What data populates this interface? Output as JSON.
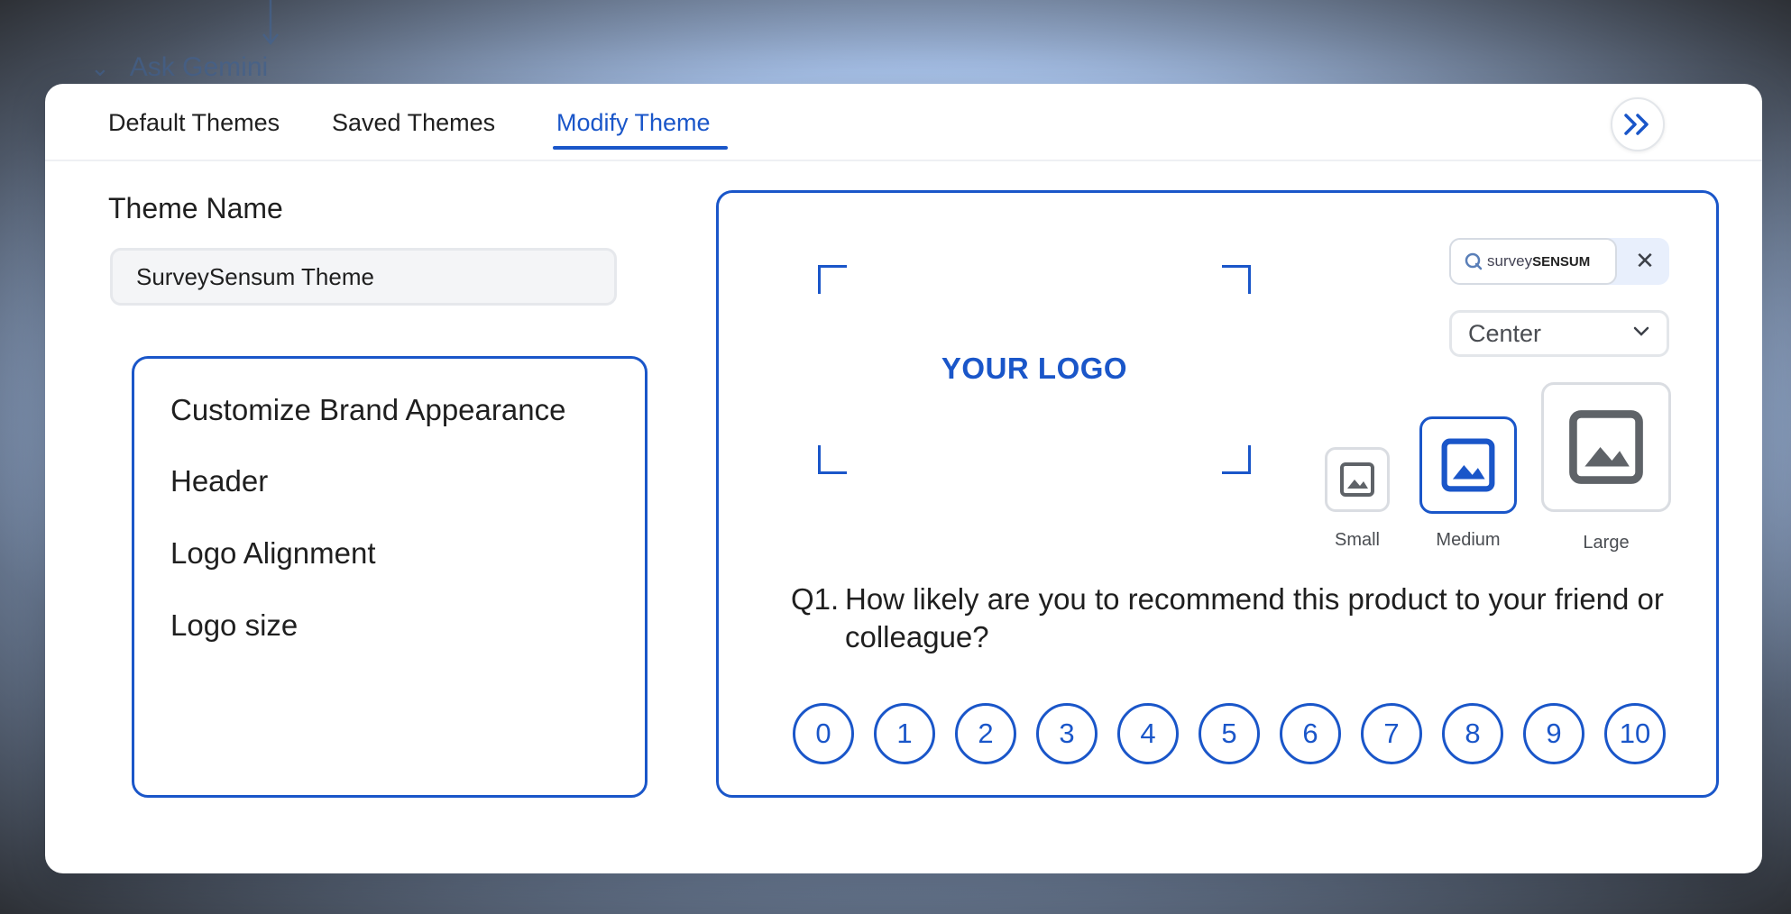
{
  "background": {
    "ask_label": "Ask Gemini"
  },
  "tabs": {
    "default_label": "Default Themes",
    "saved_label": "Saved Themes",
    "modify_label": "Modify Theme",
    "active": "Modify Theme"
  },
  "theme": {
    "label": "Theme Name",
    "value": "SurveySensum Theme"
  },
  "menu": {
    "items": [
      {
        "label": "Customize Brand Appearance"
      },
      {
        "label": "Header"
      },
      {
        "label": "Logo Alignment"
      },
      {
        "label": "Logo size"
      }
    ]
  },
  "preview": {
    "logo_placeholder": "YOUR LOGO",
    "brand_logo_text": "survey",
    "brand_logo_bold": "SENSUM",
    "close_symbol": "✕",
    "alignment_value": "Center",
    "sizes": [
      {
        "label": "Small"
      },
      {
        "label": "Medium"
      },
      {
        "label": "Large"
      }
    ],
    "selected_size": "Medium",
    "question_number": "Q1.",
    "question_text": "How likely  are you to  recommend this product to your friend or colleague?",
    "scale": [
      "0",
      "1",
      "2",
      "3",
      "4",
      "5",
      "6",
      "7",
      "8",
      "9",
      "10"
    ]
  },
  "colors": {
    "accent": "#1a56c9",
    "text": "#1f1f1f",
    "border_gray": "#dadde2"
  },
  "icons": {
    "collapse": "double-chevron-right-icon",
    "dropdown": "chevron-down-icon",
    "image": "image-icon"
  }
}
